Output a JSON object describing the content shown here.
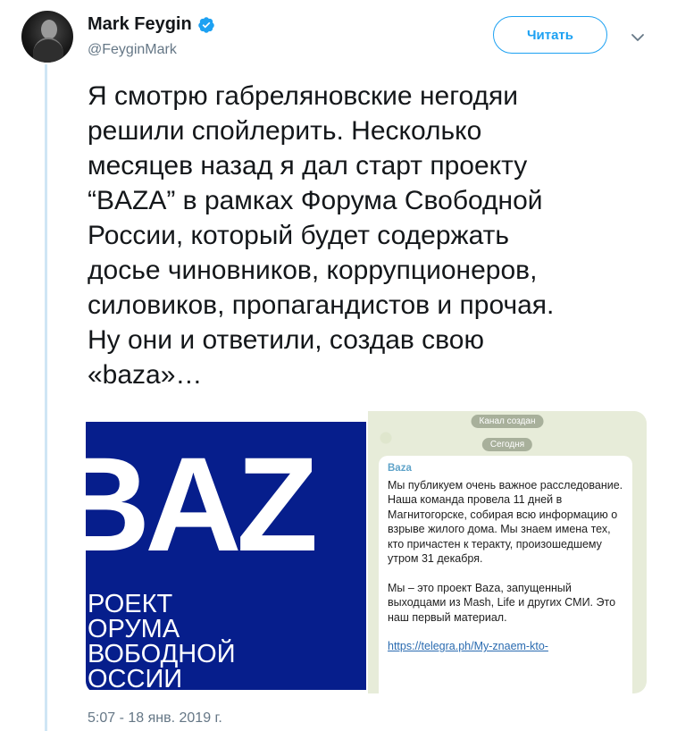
{
  "author": {
    "name": "Mark Feygin",
    "handle": "@FeyginMark",
    "verified": true,
    "verified_color": "#1da1f2"
  },
  "follow_button": {
    "label": "Читать"
  },
  "menu_icon": "chevron-down-icon",
  "tweet": {
    "text": "Я смотрю габреляновские негодяи\nрешили спойлерить. Несколько\nмесяцев назад я дал старт проекту\n“BAZA” в рамках Форума Свободной\nРоссии, который будет содержать\nдосье чиновников, коррупционеров,\nсиловиков, пропагандистов и прочая.\nНу они и ответили, создав свою\n«baza»…",
    "timestamp": "5:07 - 18 янв. 2019 г."
  },
  "media": {
    "image1": {
      "logo_text": "BAZ",
      "caption": "РОЕКТ\nОРУМА\nВОБОДНОЙ\nОССИИ",
      "bg_color": "#061e8c"
    },
    "image2": {
      "pill_channel_created": "Канал создан",
      "pill_today": "Сегодня",
      "message_author": "Baza",
      "paragraph1": "Мы публикуем очень важное расследование. Наша команда провела 11 дней в Магнитогорске, собирая всю информацию о взрыве жилого дома. Мы знаем имена тех, кто причастен к теракту, произошедшему утром 31 декабря.",
      "paragraph2": "Мы – это проект Baza, запущенный выходцами из Mash, Life и других СМИ. Это наш первый материал.",
      "link": "https://telegra.ph/My-znaem-kto-"
    }
  },
  "colors": {
    "accent": "#1da1f2",
    "secondary_text": "#657786",
    "thread_line": "#cfe6f5"
  }
}
